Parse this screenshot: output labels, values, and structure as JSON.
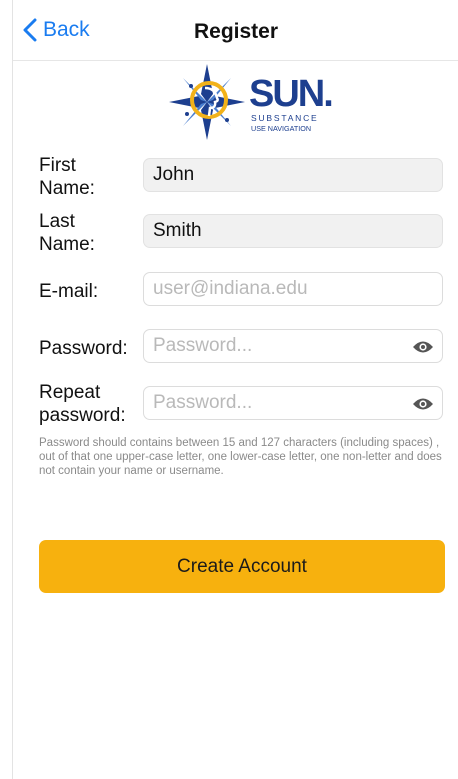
{
  "nav": {
    "back_label": "Back",
    "title": "Register"
  },
  "logo": {
    "brand": "SUN.",
    "line1": "SUBSTANCE",
    "line2": "USE NAVIGATION",
    "color_primary": "#1d3f8f",
    "color_accent": "#f2b21a"
  },
  "form": {
    "first_name_label_1": "First",
    "first_name_label_2": "Name:",
    "first_name_value": "John",
    "last_name_label_1": "Last",
    "last_name_label_2": "Name:",
    "last_name_value": "Smith",
    "email_label": "E-mail:",
    "email_placeholder": "user@indiana.edu",
    "password_label": "Password:",
    "password_placeholder": "Password...",
    "repeat_label_1": "Repeat",
    "repeat_label_2": "password:",
    "repeat_placeholder": "Password...",
    "hint": "Password should contains between 15 and 127 characters (including spaces) , out of that one upper-case letter, one lower-case letter, one non-letter and does not contain your name or username."
  },
  "actions": {
    "create_label": "Create Account",
    "button_color": "#f7b10e"
  },
  "icons": {
    "back": "chevron-left-icon",
    "show_password": "eye-icon"
  }
}
